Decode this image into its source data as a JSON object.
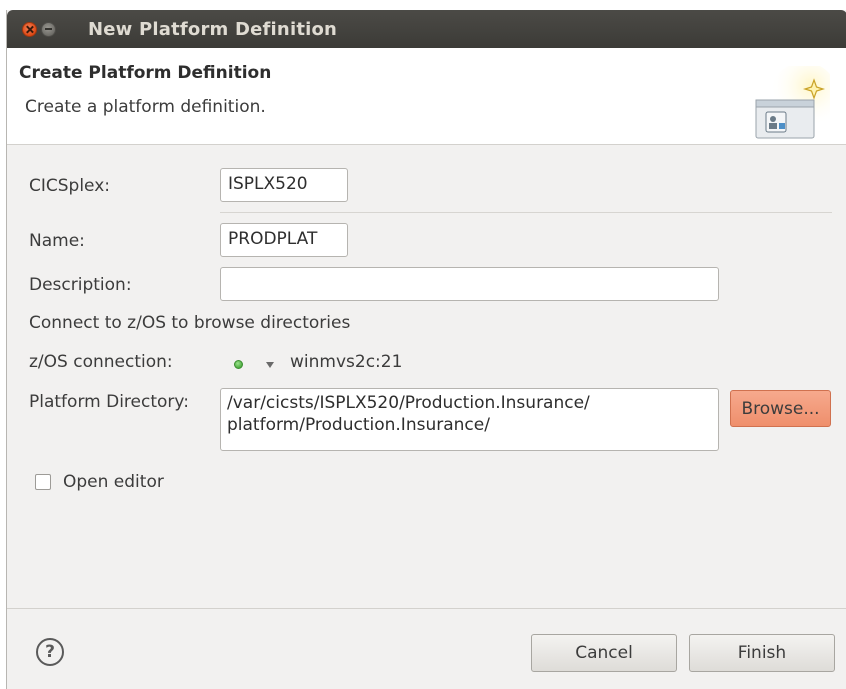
{
  "window": {
    "title": "New Platform Definition"
  },
  "banner": {
    "title": "Create Platform Definition",
    "description": "Create a platform definition.",
    "image_icon": "wizard-platform-banner-icon"
  },
  "form": {
    "cicsplex": {
      "label": "CICSplex:",
      "value": "ISPLX520"
    },
    "name": {
      "label": "Name:",
      "value": "PRODPLAT"
    },
    "description": {
      "label": "Description:",
      "value": ""
    },
    "connect_hint": "Connect to z/OS to browse directories",
    "zos_connection": {
      "label": "z/OS connection:",
      "value": "winmvs2c:21",
      "status_color": "#49a83c",
      "status_icon": "connected-status-icon"
    },
    "platform_directory": {
      "label": "Platform Directory:",
      "line1": "/var/cicsts/ISPLX520/Production.Insurance/",
      "line2": "platform/Production.Insurance/"
    },
    "browse_label": "Browse...",
    "open_editor": {
      "label": "Open editor",
      "checked": false
    }
  },
  "footer": {
    "help_icon": "help-icon",
    "cancel_label": "Cancel",
    "finish_label": "Finish"
  },
  "colors": {
    "titlebar": "#3c3b37",
    "close_button": "#dd4814",
    "browse_button": "#ef8f6c",
    "dialog_background": "#f2f1f0"
  }
}
